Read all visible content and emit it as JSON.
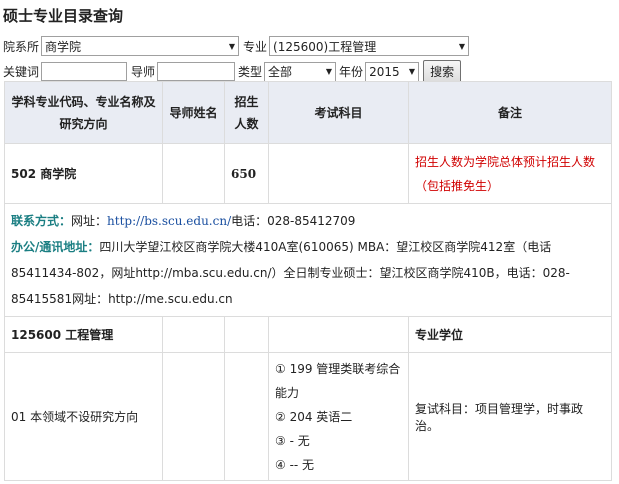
{
  "page_title": "硕士专业目录查询",
  "form": {
    "dept_label": "院系所",
    "dept_value": "商学院",
    "major_label": "专业",
    "major_value": "(125600)工程管理",
    "keyword_label": "关键词",
    "keyword_value": "",
    "advisor_label": "导师",
    "advisor_value": "",
    "type_label": "类型",
    "type_value": "全部",
    "year_label": "年份",
    "year_value": "2015",
    "search_label": "搜索"
  },
  "table": {
    "headers": [
      "学科专业代码、专业名称及研究方向",
      "导师姓名",
      "招生人数",
      "考试科目",
      "备注"
    ],
    "school_row": {
      "name": "502 商学院",
      "quota": "650",
      "note": "招生人数为学院总体预计招生人数（包括推免生）"
    },
    "contact": {
      "label1": "联系方式：",
      "text1a": "网址：",
      "url1": "http://bs.scu.edu.cn/",
      "text1b": "电话：028-85412709",
      "label2": "办公/通讯地址：",
      "text2": "四川大学望江校区商学院大楼410A室(610065) MBA：望江校区商学院412室（电话85411434-802，网址http://mba.scu.edu.cn/）全日制专业硕士：望江校区商学院410B，电话：028-85415581网址：http://me.scu.edu.cn"
    },
    "major_row": {
      "name": "125600 工程管理",
      "note": "专业学位"
    },
    "direction_row": {
      "name": "01 本领域不设研究方向",
      "courses": [
        "① 199 管理类联考综合能力",
        "② 204 英语二",
        "③ - 无",
        "④ -- 无"
      ],
      "note": "复试科目：项目管理学，时事政治。"
    }
  }
}
